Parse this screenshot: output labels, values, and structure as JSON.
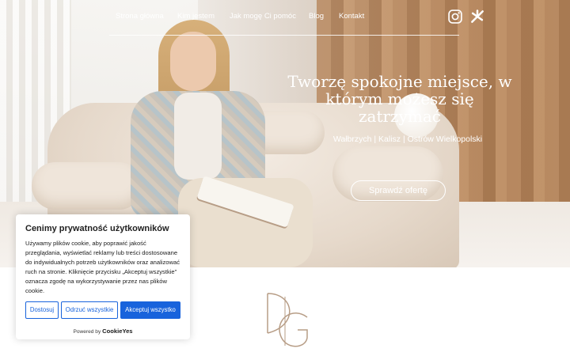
{
  "nav": {
    "items": [
      {
        "label": "Strona główna"
      },
      {
        "label": "Kim jestem"
      },
      {
        "label": "Jak mogę Ci pomóc"
      },
      {
        "label": "Blog"
      },
      {
        "label": "Kontakt"
      }
    ],
    "social": [
      "instagram-icon",
      "booksy-icon"
    ]
  },
  "hero": {
    "title_line1": "Tworzę spokojne miejsce, w",
    "title_line2": "którym możesz się zatrzymać",
    "subtitle": "Wałbrzych | Kalisz | Ostrów Wielkopolski",
    "cta": "Sprawdź ofertę"
  },
  "logo": {
    "text": "DG",
    "color": "#b79d86"
  },
  "cookie": {
    "title": "Cenimy prywatność użytkowników",
    "text": "Używamy plików cookie, aby poprawić jakość przeglądania, wyświetlać reklamy lub treści dostosowane do indywidualnych potrzeb użytkowników oraz analizować ruch na stronie. Kliknięcie przycisku „Akceptuj wszystkie” oznacza zgodę na wykorzystywanie przez nas plików cookie.",
    "buttons": {
      "customize": "Dostosuj",
      "reject": "Odrzuć wszystkie",
      "accept": "Akceptuj wszystko"
    },
    "powered_by": "Powered by",
    "brand": "CookieYes",
    "accent": "#1863dc"
  }
}
